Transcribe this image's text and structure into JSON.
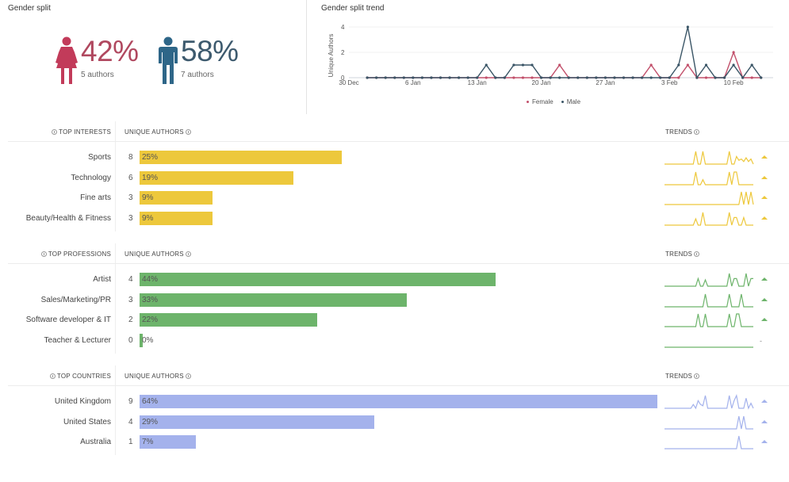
{
  "gender_split": {
    "title": "Gender split",
    "female": {
      "percent": "42%",
      "count": "5 authors",
      "color": "#c23b5a",
      "icon": "female-person-icon"
    },
    "male": {
      "percent": "58%",
      "count": "7 authors",
      "color": "#2e6688",
      "icon": "male-person-icon"
    }
  },
  "gender_trend": {
    "title": "Gender split trend",
    "legend": {
      "female": "Female",
      "male": "Male"
    },
    "chart_data": {
      "type": "line",
      "title": "Gender split trend",
      "xlabel": "",
      "ylabel": "Unique Authors",
      "ylim": [
        0,
        4
      ],
      "yticks": [
        "0",
        "2",
        "4"
      ],
      "xtick_labels": [
        "30 Dec",
        "6 Jan",
        "13 Jan",
        "20 Jan",
        "27 Jan",
        "3 Feb",
        "10 Feb"
      ],
      "x": [
        "1 Jan",
        "2 Jan",
        "3 Jan",
        "4 Jan",
        "5 Jan",
        "6 Jan",
        "7 Jan",
        "8 Jan",
        "9 Jan",
        "10 Jan",
        "11 Jan",
        "12 Jan",
        "13 Jan",
        "14 Jan",
        "15 Jan",
        "16 Jan",
        "17 Jan",
        "18 Jan",
        "19 Jan",
        "20 Jan",
        "21 Jan",
        "22 Jan",
        "23 Jan",
        "24 Jan",
        "25 Jan",
        "26 Jan",
        "27 Jan",
        "28 Jan",
        "29 Jan",
        "30 Jan",
        "31 Jan",
        "1 Feb",
        "2 Feb",
        "3 Feb",
        "4 Feb",
        "5 Feb",
        "6 Feb",
        "7 Feb",
        "8 Feb",
        "9 Feb",
        "10 Feb",
        "11 Feb",
        "12 Feb",
        "13 Feb"
      ],
      "series": [
        {
          "name": "Female",
          "color": "#c2506b",
          "values": [
            0,
            0,
            0,
            0,
            0,
            0,
            0,
            0,
            0,
            0,
            0,
            0,
            0,
            0,
            0,
            0,
            0,
            0,
            0,
            0,
            0,
            1,
            0,
            0,
            0,
            0,
            0,
            0,
            0,
            0,
            0,
            1,
            0,
            0,
            0,
            1,
            0,
            0,
            0,
            0,
            2,
            0,
            0,
            0
          ]
        },
        {
          "name": "Male",
          "color": "#3a5566",
          "values": [
            0,
            0,
            0,
            0,
            0,
            0,
            0,
            0,
            0,
            0,
            0,
            0,
            0,
            1,
            0,
            0,
            1,
            1,
            1,
            0,
            0,
            0,
            0,
            0,
            0,
            0,
            0,
            0,
            0,
            0,
            0,
            0,
            0,
            0,
            1,
            4,
            0,
            1,
            0,
            0,
            1,
            0,
            1,
            0
          ]
        }
      ],
      "grid": true,
      "legend": "bottom-right"
    }
  },
  "sections": [
    {
      "id": "interests",
      "header": "TOP INTERESTS",
      "unique_authors_label": "UNIQUE AUTHORS",
      "trends_label": "TRENDS",
      "color": "#edc83c",
      "rows": [
        {
          "label": "Sports",
          "count": "8",
          "percent": 25,
          "percent_label": "25%",
          "trend": [
            0,
            0,
            0,
            0,
            0,
            0,
            0,
            0,
            0,
            0,
            0,
            0,
            0,
            1,
            0,
            0,
            1,
            0,
            0,
            0,
            0,
            0,
            0,
            0,
            0,
            0,
            0,
            1,
            0,
            0,
            0.6,
            0.3,
            0.4,
            0.2,
            0.5,
            0.2,
            0.4,
            0
          ],
          "trend_dir": "up"
        },
        {
          "label": "Technology",
          "count": "6",
          "percent": 19,
          "percent_label": "19%",
          "trend": [
            0,
            0,
            0,
            0,
            0,
            0,
            0,
            0,
            0,
            0,
            0,
            0,
            0,
            1,
            0,
            0,
            0.4,
            0,
            0,
            0,
            0,
            0,
            0,
            0,
            0,
            0,
            0,
            1,
            0,
            1,
            1,
            0,
            0,
            0,
            0,
            0,
            0,
            0
          ],
          "trend_dir": "up"
        },
        {
          "label": "Fine arts",
          "count": "3",
          "percent": 9,
          "percent_label": "9%",
          "trend": [
            0,
            0,
            0,
            0,
            0,
            0,
            0,
            0,
            0,
            0,
            0,
            0,
            0,
            0,
            0,
            0,
            0,
            0,
            0,
            0,
            0,
            0,
            0,
            0,
            0,
            0,
            0,
            0,
            0,
            0,
            0,
            0,
            1,
            0,
            1,
            0,
            1,
            0
          ],
          "trend_dir": "up"
        },
        {
          "label": "Beauty/Health & Fitness",
          "count": "3",
          "percent": 9,
          "percent_label": "9%",
          "trend": [
            0,
            0,
            0,
            0,
            0,
            0,
            0,
            0,
            0,
            0,
            0,
            0,
            0,
            0.5,
            0,
            0,
            1,
            0,
            0,
            0,
            0,
            0,
            0,
            0,
            0,
            0,
            0,
            1,
            0,
            0.6,
            0.6,
            0,
            0,
            0.6,
            0,
            0,
            0,
            0
          ],
          "trend_dir": "up"
        }
      ]
    },
    {
      "id": "professions",
      "header": "TOP PROFESSIONS",
      "unique_authors_label": "UNIQUE AUTHORS",
      "trends_label": "TRENDS",
      "color": "#6db46b",
      "rows": [
        {
          "label": "Artist",
          "count": "4",
          "percent": 44,
          "percent_label": "44%",
          "trend": [
            0,
            0,
            0,
            0,
            0,
            0,
            0,
            0,
            0,
            0,
            0,
            0,
            0,
            0,
            0.6,
            0,
            0,
            0.5,
            0,
            0,
            0,
            0,
            0,
            0,
            0,
            0,
            0,
            1,
            0,
            0.6,
            0.6,
            0,
            0,
            0,
            1,
            0,
            0.6,
            0.6
          ],
          "trend_dir": "up"
        },
        {
          "label": "Sales/Marketing/PR",
          "count": "3",
          "percent": 33,
          "percent_label": "33%",
          "trend": [
            0,
            0,
            0,
            0,
            0,
            0,
            0,
            0,
            0,
            0,
            0,
            0,
            0,
            0,
            0,
            0,
            0,
            1,
            0,
            0,
            0,
            0,
            0,
            0,
            0,
            0,
            0,
            1,
            0,
            0,
            0,
            0,
            1,
            0,
            0,
            0,
            0,
            0
          ],
          "trend_dir": "up"
        },
        {
          "label": "Software developer & IT",
          "count": "2",
          "percent": 22,
          "percent_label": "22%",
          "trend": [
            0,
            0,
            0,
            0,
            0,
            0,
            0,
            0,
            0,
            0,
            0,
            0,
            0,
            0,
            1,
            0,
            0,
            1,
            0,
            0,
            0,
            0,
            0,
            0,
            0,
            0,
            0,
            1,
            0,
            0,
            1,
            1,
            0,
            0,
            0,
            0,
            0,
            0
          ],
          "trend_dir": "up"
        },
        {
          "label": "Teacher & Lecturer",
          "count": "0",
          "percent": 0,
          "percent_label": "0%",
          "trend": [
            0,
            0,
            0,
            0,
            0,
            0,
            0,
            0,
            0,
            0,
            0,
            0,
            0,
            0,
            0,
            0,
            0,
            0,
            0,
            0,
            0,
            0,
            0,
            0,
            0,
            0,
            0,
            0,
            0,
            0,
            0,
            0,
            0,
            0,
            0,
            0,
            0,
            0
          ],
          "trend_dir": "flat",
          "trend_flat_symbol": "-"
        }
      ]
    },
    {
      "id": "countries",
      "header": "TOP COUNTRIES",
      "unique_authors_label": "UNIQUE AUTHORS",
      "trends_label": "TRENDS",
      "color": "#a4b2ec",
      "rows": [
        {
          "label": "United Kingdom",
          "count": "9",
          "percent": 64,
          "percent_label": "64%",
          "trend": [
            0,
            0,
            0,
            0,
            0,
            0,
            0,
            0,
            0,
            0,
            0,
            0,
            0.3,
            0,
            0.6,
            0.3,
            0.2,
            1,
            0,
            0,
            0,
            0,
            0,
            0,
            0,
            0,
            0,
            1,
            0,
            0.6,
            1,
            0,
            0,
            0,
            0.8,
            0,
            0.4,
            0
          ],
          "trend_dir": "up"
        },
        {
          "label": "United States",
          "count": "4",
          "percent": 29,
          "percent_label": "29%",
          "trend": [
            0,
            0,
            0,
            0,
            0,
            0,
            0,
            0,
            0,
            0,
            0,
            0,
            0,
            0,
            0,
            0,
            0,
            0,
            0,
            0,
            0,
            0,
            0,
            0,
            0,
            0,
            0,
            0,
            0,
            0,
            0,
            1,
            0,
            1,
            0,
            0,
            0,
            0
          ],
          "trend_dir": "up"
        },
        {
          "label": "Australia",
          "count": "1",
          "percent": 7,
          "percent_label": "7%",
          "trend": [
            0,
            0,
            0,
            0,
            0,
            0,
            0,
            0,
            0,
            0,
            0,
            0,
            0,
            0,
            0,
            0,
            0,
            0,
            0,
            0,
            0,
            0,
            0,
            0,
            0,
            0,
            0,
            0,
            0,
            0,
            0,
            1,
            0,
            0,
            0,
            0,
            0,
            0
          ],
          "trend_dir": "up"
        }
      ]
    }
  ]
}
